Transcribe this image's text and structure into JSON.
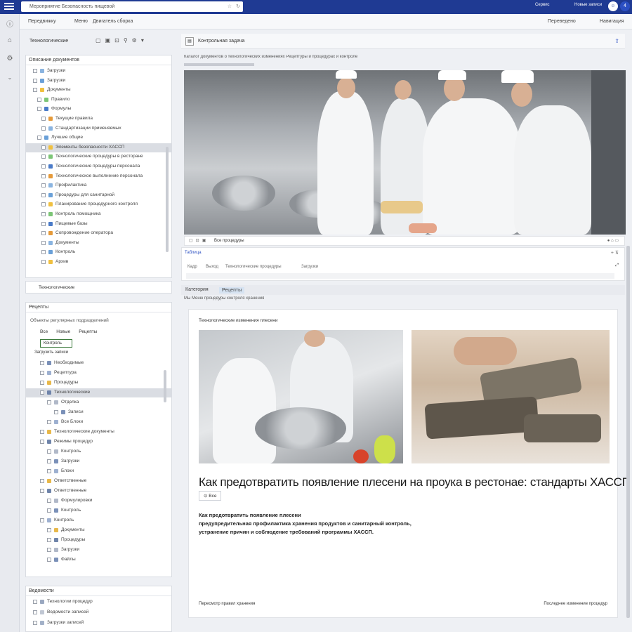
{
  "topbar": {
    "url": "Мероприятие Безопасность пищевой",
    "right1": "Сервис",
    "right2": "Новые записи",
    "badge": "4"
  },
  "toolbar": {
    "item1": "Передвижку",
    "item2": "Меню",
    "item3": "Двигатель сборка",
    "right1": "Переведено",
    "right2": "Навигация"
  },
  "left_header": {
    "title": "Технологические"
  },
  "panel1": {
    "title": "Описание документов",
    "items": [
      {
        "label": "Загрузки"
      },
      {
        "label": "Загрузки"
      },
      {
        "label": "Документы"
      },
      {
        "label": "Правило"
      },
      {
        "label": "Формулы"
      },
      {
        "label": "Текущие правила"
      },
      {
        "label": "Стандартизации применяемых"
      },
      {
        "label": "Лучшие общие"
      },
      {
        "label": "Элементы безопасности ХАССП"
      },
      {
        "label": "Технологические процедуры в ресторане"
      },
      {
        "label": "Технологические процедуры персонала"
      },
      {
        "label": "Технологическое выполнение персонала"
      },
      {
        "label": "Профилактика"
      },
      {
        "label": "Процедуры для санитарной"
      },
      {
        "label": "Планирование процедурного контроля"
      },
      {
        "label": "Контроль помощника"
      },
      {
        "label": "Пищевые базы"
      },
      {
        "label": "Сопровождение оператора"
      },
      {
        "label": "Документы"
      },
      {
        "label": "Контроль"
      },
      {
        "label": "Архив"
      }
    ],
    "footer": "Технологические"
  },
  "panel2": {
    "title": "Рецепты",
    "search": "Объекты регулярных подразделений",
    "tabs": [
      "Все",
      "Новые",
      "Рецепты"
    ],
    "filter": "Контроль",
    "subfilter": "Загрузить записи",
    "items": [
      {
        "label": "Необходимые"
      },
      {
        "label": "Рецептура"
      },
      {
        "label": "Процедуры"
      },
      {
        "label": "Технологические"
      },
      {
        "label": "Отделка"
      },
      {
        "label": "Записи"
      },
      {
        "label": "Все Блоки"
      },
      {
        "label": "Технологические документы"
      },
      {
        "label": "Режимы процедур"
      },
      {
        "label": "Контроль"
      },
      {
        "label": "Загрузки"
      },
      {
        "label": "Блоки"
      },
      {
        "label": "Ответственные"
      },
      {
        "label": "Ответственные"
      },
      {
        "label": "Формулировки"
      },
      {
        "label": "Контроль"
      },
      {
        "label": "Контроль"
      },
      {
        "label": "Документы"
      },
      {
        "label": "Процедуры"
      },
      {
        "label": "Загрузки"
      },
      {
        "label": "Файлы"
      }
    ]
  },
  "panel3": {
    "title": "Ведомости",
    "items": [
      {
        "label": "Технологии процедур"
      },
      {
        "label": "Ведомости записей"
      },
      {
        "label": "Загрузки записей"
      }
    ]
  },
  "article": {
    "breadcrumb": "Контрольная задача",
    "subline": "Каталог документов о технологических изменениях Рецептуры и процедурах и контроле",
    "hero_caption": "Все процедуры",
    "comments_label": "Таблица",
    "columns": [
      "Кадр",
      "Выход",
      "Технологические процедуры",
      "Загрузки"
    ],
    "tabs": [
      "Категория",
      "Рецепты"
    ],
    "tab_path": "Мы Меню процедуры контроля хранения",
    "card_source": "Технологические изменения плесени",
    "title": "Как предотвратить появление плесени на проука в рестонае: стандарты ХАССП",
    "tag": "Все",
    "paragraph": [
      "Как предотвратить появление плесени",
      "предупредительная профилактика хранения продуктов и санитарный контроль,",
      "устранение причин и соблюдение требований программы ХАССП."
    ],
    "footer_left": "Пересмотр правил хранения",
    "footer_right": "Последнее изменение процедур"
  }
}
